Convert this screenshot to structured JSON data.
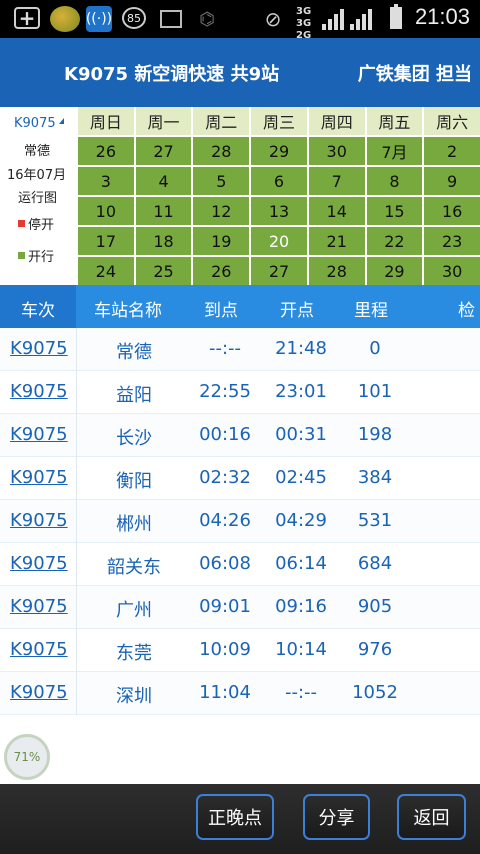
{
  "status_bar": {
    "battery_percent_badge": "85",
    "network_top": "3G",
    "network_mid": "3G",
    "network_bottom": "2G",
    "time": "21:03"
  },
  "header": {
    "title": "K9075 新空调快速 共9站",
    "operator": "广铁集团 担当"
  },
  "calendar": {
    "train": "K9075",
    "station": "常德",
    "month": "16年07月",
    "chart_label": "运行图",
    "legend_stop": "停开",
    "legend_run": "开行",
    "colors": {
      "stop": "#e53935",
      "run": "#77a93f",
      "header": "#e2ecc4"
    },
    "weekdays": [
      "周日",
      "周一",
      "周二",
      "周三",
      "周四",
      "周五",
      "周六"
    ],
    "weeks": [
      [
        "26",
        "27",
        "28",
        "29",
        "30",
        "7月",
        "2"
      ],
      [
        "3",
        "4",
        "5",
        "6",
        "7",
        "8",
        "9"
      ],
      [
        "10",
        "11",
        "12",
        "13",
        "14",
        "15",
        "16"
      ],
      [
        "17",
        "18",
        "19",
        "20",
        "21",
        "22",
        "23"
      ],
      [
        "24",
        "25",
        "26",
        "27",
        "28",
        "29",
        "30"
      ]
    ],
    "today": "20"
  },
  "table": {
    "headers": {
      "train": "车次",
      "station": "车站名称",
      "arrive": "到点",
      "depart": "开点",
      "mileage": "里程",
      "check": "检"
    },
    "rows": [
      {
        "train": "K9075",
        "station": "常德",
        "arrive": "--:--",
        "depart": "21:48",
        "km": "0"
      },
      {
        "train": "K9075",
        "station": "益阳",
        "arrive": "22:55",
        "depart": "23:01",
        "km": "101"
      },
      {
        "train": "K9075",
        "station": "长沙",
        "arrive": "00:16",
        "depart": "00:31",
        "km": "198"
      },
      {
        "train": "K9075",
        "station": "衡阳",
        "arrive": "02:32",
        "depart": "02:45",
        "km": "384"
      },
      {
        "train": "K9075",
        "station": "郴州",
        "arrive": "04:26",
        "depart": "04:29",
        "km": "531"
      },
      {
        "train": "K9075",
        "station": "韶关东",
        "arrive": "06:08",
        "depart": "06:14",
        "km": "684"
      },
      {
        "train": "K9075",
        "station": "广州",
        "arrive": "09:01",
        "depart": "09:16",
        "km": "905"
      },
      {
        "train": "K9075",
        "station": "东莞",
        "arrive": "10:09",
        "depart": "10:14",
        "km": "976"
      },
      {
        "train": "K9075",
        "station": "深圳",
        "arrive": "11:04",
        "depart": "--:--",
        "km": "1052"
      }
    ]
  },
  "progress": {
    "label": "71%"
  },
  "bottom_bar": {
    "late_label": "正晚点",
    "share_label": "分享",
    "back_label": "返回"
  }
}
